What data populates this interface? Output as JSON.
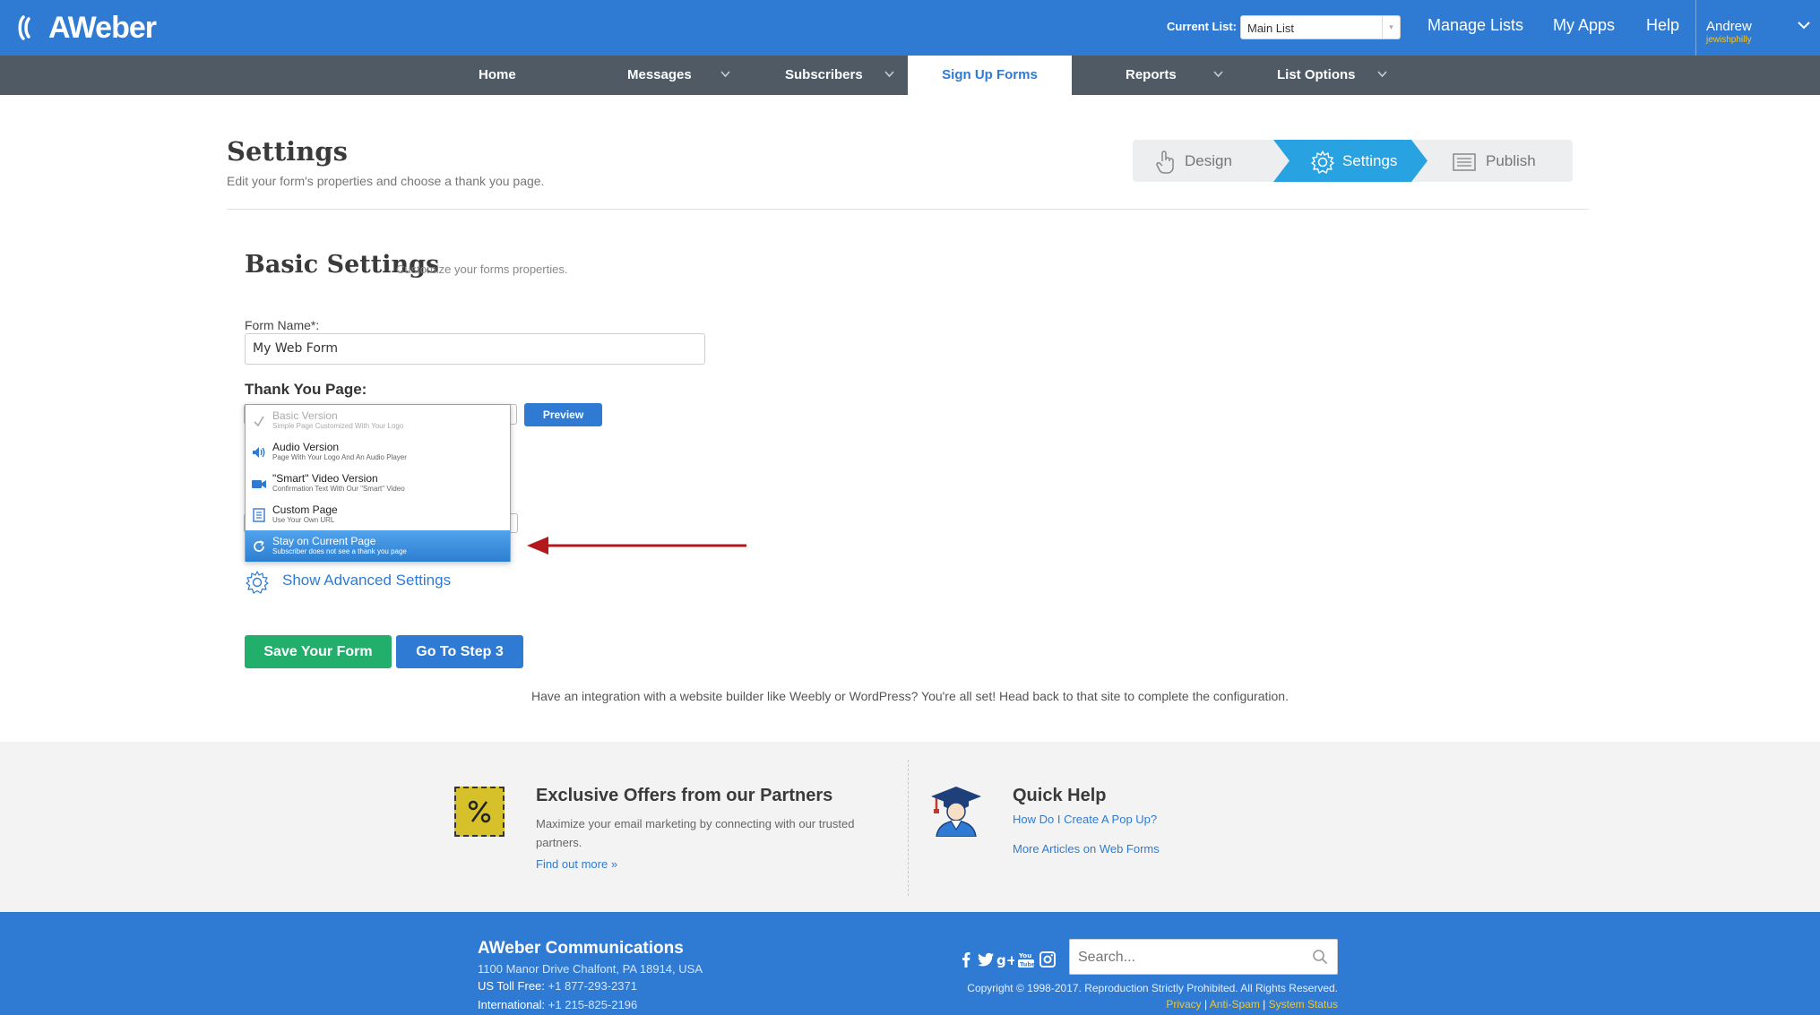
{
  "header": {
    "logo_text": "AWeber",
    "current_list_label": "Current List:",
    "current_list_value": "Main List",
    "nav": [
      "Manage Lists",
      "My Apps",
      "Help"
    ],
    "user_name": "Andrew",
    "user_account": "jewishphilly"
  },
  "subnav": {
    "items": [
      "Home",
      "Messages",
      "Subscribers",
      "Sign Up Forms",
      "Reports",
      "List Options"
    ],
    "active": "Sign Up Forms"
  },
  "page": {
    "title": "Settings",
    "subtitle": "Edit your form's properties and choose a thank you page.",
    "steps": [
      "Design",
      "Settings",
      "Publish"
    ],
    "active_step": "Settings"
  },
  "basic": {
    "title": "Basic Settings",
    "subtitle": "Customize your forms properties.",
    "form_name_label": "Form Name*:",
    "form_name_value": "My Web Form",
    "thank_you_label": "Thank You Page:",
    "preview_label": "Preview",
    "options": [
      {
        "title": "Basic Version",
        "desc": "Simple Page Customized With Your Logo",
        "icon": "check-icon",
        "state": "disabled"
      },
      {
        "title": "Audio Version",
        "desc": "Page With Your Logo And An Audio Player",
        "icon": "speaker-icon",
        "state": "normal"
      },
      {
        "title": "\"Smart\" Video Version",
        "desc": "Confirmation Text With Our \"Smart\" Video",
        "icon": "video-camera-icon",
        "state": "normal"
      },
      {
        "title": "Custom Page",
        "desc": "Use Your Own URL",
        "icon": "document-icon",
        "state": "normal"
      },
      {
        "title": "Stay on Current Page",
        "desc": "Subscriber does not see a thank you page",
        "icon": "refresh-icon",
        "state": "selected"
      }
    ],
    "advanced_label": "Show Advanced Settings",
    "save_label": "Save Your Form",
    "next_label": "Go To Step 3",
    "integration_note": "Have an integration with a website builder like Weebly or WordPress? You're all set! Head back to that site to complete the configuration."
  },
  "band": {
    "offers_title": "Exclusive Offers from our Partners",
    "offers_text": "Maximize your email marketing by connecting with our trusted partners.",
    "offers_link": "Find out more »",
    "help_title": "Quick Help",
    "help_link1": "How Do I Create A Pop Up?",
    "help_link2": "More Articles on Web Forms"
  },
  "footer": {
    "company": "AWeber Communications",
    "address": "1100 Manor Drive Chalfont, PA 18914, USA",
    "tollfree_label": "US Toll Free:",
    "tollfree_number": "+1 877-293-2371",
    "intl_label": "International:",
    "intl_number": "+1 215-825-2196",
    "search_placeholder": "Search...",
    "copyright": "Copyright © 1998-2017. Reproduction Strictly Prohibited. All Rights Reserved.",
    "links": [
      "Privacy",
      "Anti-Spam",
      "System Status"
    ],
    "social": [
      "facebook-icon",
      "twitter-icon",
      "google-plus-icon",
      "youtube-icon",
      "instagram-icon"
    ]
  },
  "colors": {
    "brand_blue": "#2f7bd3",
    "subnav_gray": "#4f5a64",
    "active_step": "#29a2e2",
    "save_green": "#22ae6b",
    "arrow_red": "#b3191c",
    "accent_yellow": "#f1c531"
  }
}
